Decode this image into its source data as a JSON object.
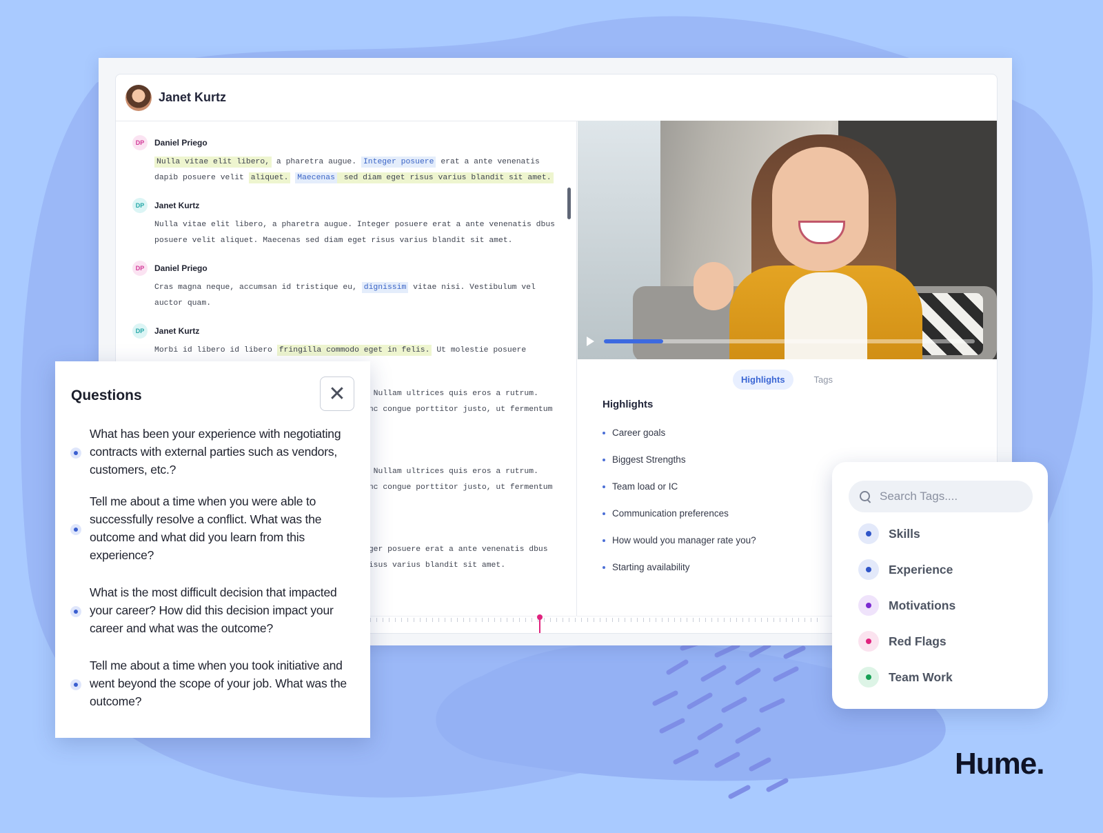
{
  "header": {
    "name": "Janet Kurtz"
  },
  "transcript": [
    {
      "initials": "DP",
      "speaker": "Daniel Priego",
      "segments": [
        {
          "t": "Nulla vitae elit libero,",
          "h": "y"
        },
        {
          "t": " a pharetra augue. ",
          "h": ""
        },
        {
          "t": "Integer posuere",
          "h": "b"
        },
        {
          "t": " erat a ante venenatis dapib posuere velit ",
          "h": ""
        },
        {
          "t": "aliquet.",
          "h": "y"
        },
        {
          "t": " ",
          "h": ""
        },
        {
          "t": "Maecenas",
          "h": "b"
        },
        {
          "t": " sed diam eget risus varius blandit sit amet.",
          "h": "y"
        }
      ]
    },
    {
      "initials": "DP",
      "speaker": "Janet Kurtz",
      "segments": [
        {
          "t": "Nulla vitae elit libero, a pharetra augue. Integer posuere erat a ante venenatis dbus posuere velit aliquet. Maecenas sed diam eget risus varius blandit sit amet.",
          "h": ""
        }
      ]
    },
    {
      "initials": "DP",
      "speaker": "Daniel Priego",
      "segments": [
        {
          "t": "Cras magna neque, accumsan id tristique eu, ",
          "h": ""
        },
        {
          "t": "dignissim",
          "h": "b"
        },
        {
          "t": " vitae nisi. Vestibulum vel auctor quam.",
          "h": ""
        }
      ]
    },
    {
      "initials": "DP",
      "speaker": "Janet Kurtz",
      "segments": [
        {
          "t": "Morbi id libero id libero ",
          "h": ""
        },
        {
          "t": "fringilla commodo eget in felis.",
          "h": "y"
        },
        {
          "t": " Ut molestie posuere dignism.",
          "h": ""
        }
      ]
    }
  ],
  "transcript_ghost": [
    ". Nullam ultrices quis eros a rutrum.",
    "unc congue porttitor justo, ut fermentum",
    ". Nullam ultrices quis eros a rutrum.",
    "unc congue porttitor justo, ut fermentum",
    "eger posuere erat a ante venenatis dbus",
    "risus varius blandit sit amet."
  ],
  "video": {
    "progress": 0.16,
    "buffered": 0.16
  },
  "tabs": [
    "Highlights",
    "Tags"
  ],
  "highlights": {
    "title": "Highlights",
    "items": [
      "Career goals",
      "Biggest Strengths",
      "Team load or IC",
      "Communication preferences",
      "How would you manager rate you?",
      "Starting availability"
    ]
  },
  "questions": {
    "title": "Questions",
    "close_symbol": "✕",
    "items": [
      "What has been your experience with negotiating contracts with external parties such as vendors, customers, etc.?",
      "Tell me about a time when you were able to successfully resolve a conflict. What was the outcome and what did you learn from this experience?",
      "What is the most difficult decision that impacted your career? How did this decision impact your career and what was the outcome?",
      "Tell me about a time when you took initiative and went beyond the scope of your job. What was the outcome?"
    ]
  },
  "tags_panel": {
    "search_placeholder": "Search Tags....",
    "tags": [
      {
        "label": "Skills",
        "color": "#2f55c8",
        "bg": "#e3e9fa"
      },
      {
        "label": "Experience",
        "color": "#2f55c8",
        "bg": "#e3e9fa"
      },
      {
        "label": "Motivations",
        "color": "#7b2ad1",
        "bg": "#efe3fb"
      },
      {
        "label": "Red Flags",
        "color": "#e0237e",
        "bg": "#fbe3ef"
      },
      {
        "label": "Team Work",
        "color": "#17a055",
        "bg": "#ddf4e6"
      }
    ]
  },
  "brand": "Hume."
}
